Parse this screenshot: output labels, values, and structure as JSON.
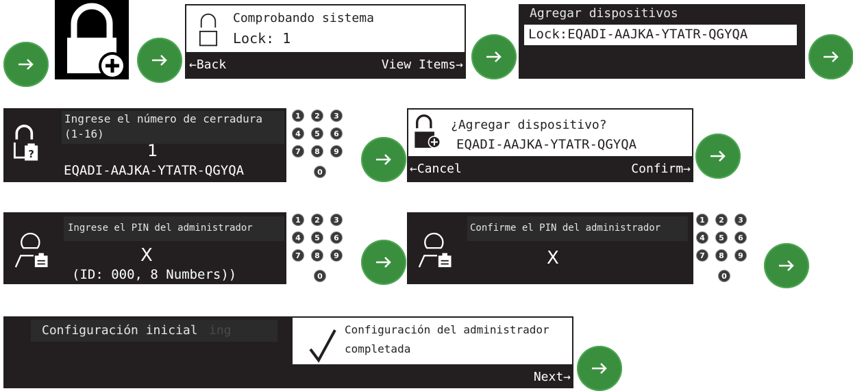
{
  "row1": {
    "screen2": {
      "title": "Comprobando sistema",
      "lock_line": "Lock: 1",
      "back_label": "←Back",
      "view_label": "View Items→"
    },
    "screen3": {
      "title": "Agregar dispositivos",
      "lock_code": "Lock:EQADI-AAJKA-YTATR-QGYQA"
    }
  },
  "row2": {
    "screen1": {
      "prompt_line1": "Ingrese el número de cerradura",
      "prompt_line2": "(1-16)",
      "value": "1",
      "code": "EQADI-AAJKA-YTATR-QGYQA"
    },
    "screen2": {
      "question": "¿Agregar dispositivo?",
      "code": "EQADI-AAJKA-YTATR-QGYQA",
      "cancel_label": "←Cancel",
      "confirm_label": "Confirm→"
    }
  },
  "row3": {
    "screen1": {
      "prompt": "Ingrese el PIN del administrador",
      "value": "X",
      "info": "(ID: 000, 8 Numbers))"
    },
    "screen2": {
      "prompt": "Confirme el PIN del administrador",
      "value": "X"
    }
  },
  "row4": {
    "screen1": {
      "title": "Configuración inicial",
      "ghost": "ing"
    },
    "screen2": {
      "line1": "Configuración del administrador",
      "line2": "completada",
      "next_label": "Next→"
    }
  },
  "keypad": {
    "keys": [
      "1",
      "2",
      "3",
      "4",
      "5",
      "6",
      "7",
      "8",
      "9",
      "0"
    ]
  },
  "colors": {
    "arrow_green": "#3a8f3f",
    "screen_dark": "#231f20"
  },
  "icons": [
    "arrow-right-icon",
    "lock-plus-icon",
    "lock-icon",
    "lock-question-icon",
    "admin-user-icon",
    "checkmark-icon"
  ]
}
